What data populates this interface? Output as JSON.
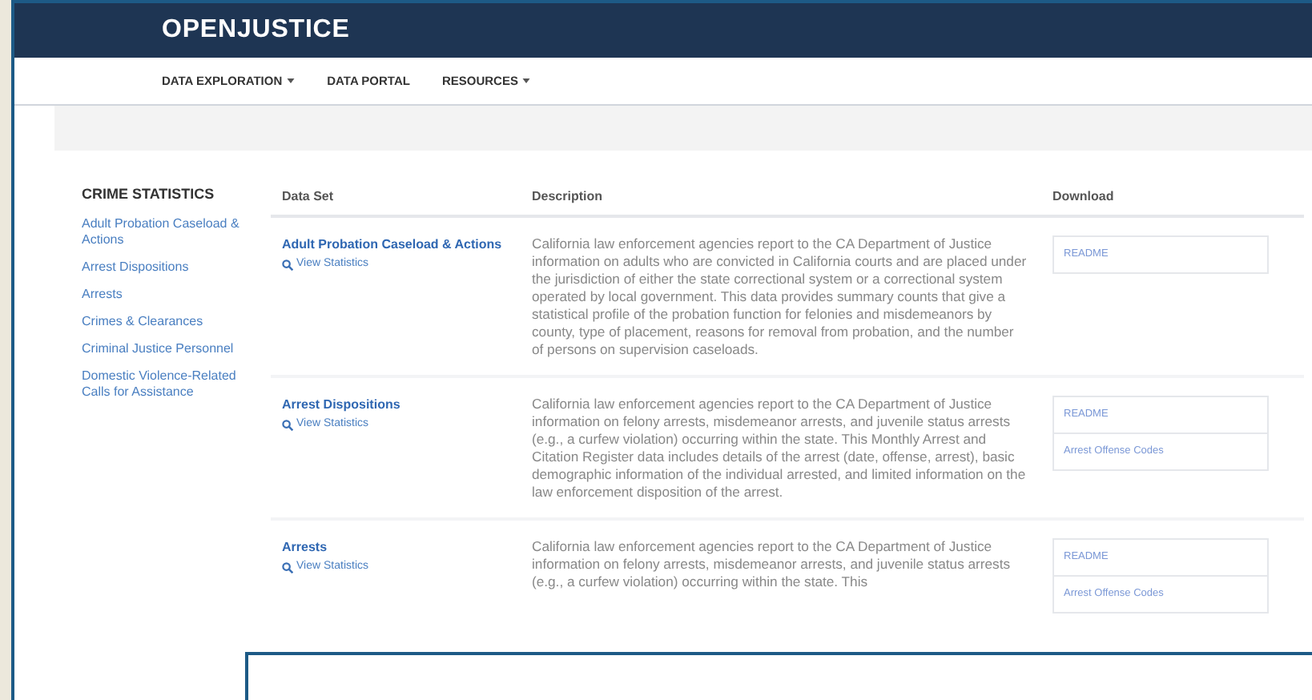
{
  "header": {
    "logo": "OPENJUSTICE"
  },
  "nav": [
    {
      "label": "DATA EXPLORATION",
      "dropdown": true
    },
    {
      "label": "DATA PORTAL",
      "dropdown": false
    },
    {
      "label": "RESOURCES",
      "dropdown": true
    }
  ],
  "sidebar": {
    "title": "CRIME STATISTICS",
    "items": [
      "Adult Probation Caseload & Actions",
      "Arrest Dispositions",
      "Arrests",
      "Crimes & Clearances",
      "Criminal Justice Personnel",
      "Domestic Violence-Related Calls for Assistance"
    ]
  },
  "table": {
    "columns": [
      "Data Set",
      "Description",
      "Download"
    ],
    "rows": [
      {
        "dataset": "Adult Probation Caseload & Actions",
        "stats_link": "View Statistics",
        "description": "California law enforcement agencies report to the CA Department of Justice information on adults who are convicted in California courts and are placed under the jurisdiction of either the state correctional system or a correctional system operated by local government. This data provides summary counts that give a statistical profile of the probation function for felonies and misdemeanors by county, type of placement, reasons for removal from probation, and the number of persons on supervision caseloads.",
        "downloads": [
          "README"
        ]
      },
      {
        "dataset": "Arrest Dispositions",
        "stats_link": "View Statistics",
        "description": "California law enforcement agencies report to the CA Department of Justice information on felony arrests, misdemeanor arrests, and juvenile status arrests (e.g., a curfew violation) occurring within the state. This Monthly Arrest and Citation Register data includes details of the arrest (date, offense, arrest), basic demographic information of the individual arrested, and limited information on the law enforcement disposition of the arrest.",
        "downloads": [
          "README",
          "Arrest Offense Codes"
        ]
      },
      {
        "dataset": "Arrests",
        "stats_link": "View Statistics",
        "description": "California law enforcement agencies report to the CA Department of Justice information on felony arrests, misdemeanor arrests, and juvenile status arrests (e.g., a curfew violation) occurring within the state. This",
        "downloads": [
          "README",
          "Arrest Offense Codes"
        ]
      }
    ]
  }
}
